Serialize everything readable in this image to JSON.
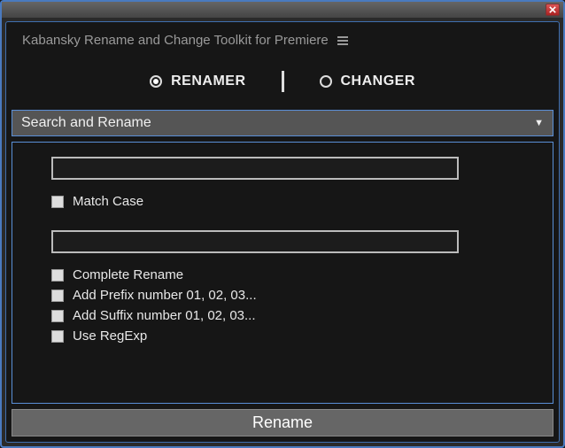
{
  "window": {
    "title_present": false
  },
  "header": {
    "title": "Kabansky Rename and Change Toolkit for Premiere"
  },
  "tabs": {
    "renamer": {
      "label": "RENAMER",
      "selected": true
    },
    "changer": {
      "label": "CHANGER",
      "selected": false
    }
  },
  "mode_dropdown": {
    "selected": "Search and Rename"
  },
  "inputs": {
    "search": {
      "value": "",
      "placeholder": ""
    },
    "replace": {
      "value": "",
      "placeholder": ""
    }
  },
  "options": {
    "match_case": {
      "label": "Match Case",
      "checked": false
    },
    "complete_rename": {
      "label": "Complete Rename",
      "checked": false
    },
    "add_prefix": {
      "label": "Add Prefix number 01, 02, 03...",
      "checked": false
    },
    "add_suffix": {
      "label": "Add Suffix number 01, 02, 03...",
      "checked": false
    },
    "use_regexp": {
      "label": "Use RegExp",
      "checked": false
    }
  },
  "buttons": {
    "rename": "Rename"
  }
}
